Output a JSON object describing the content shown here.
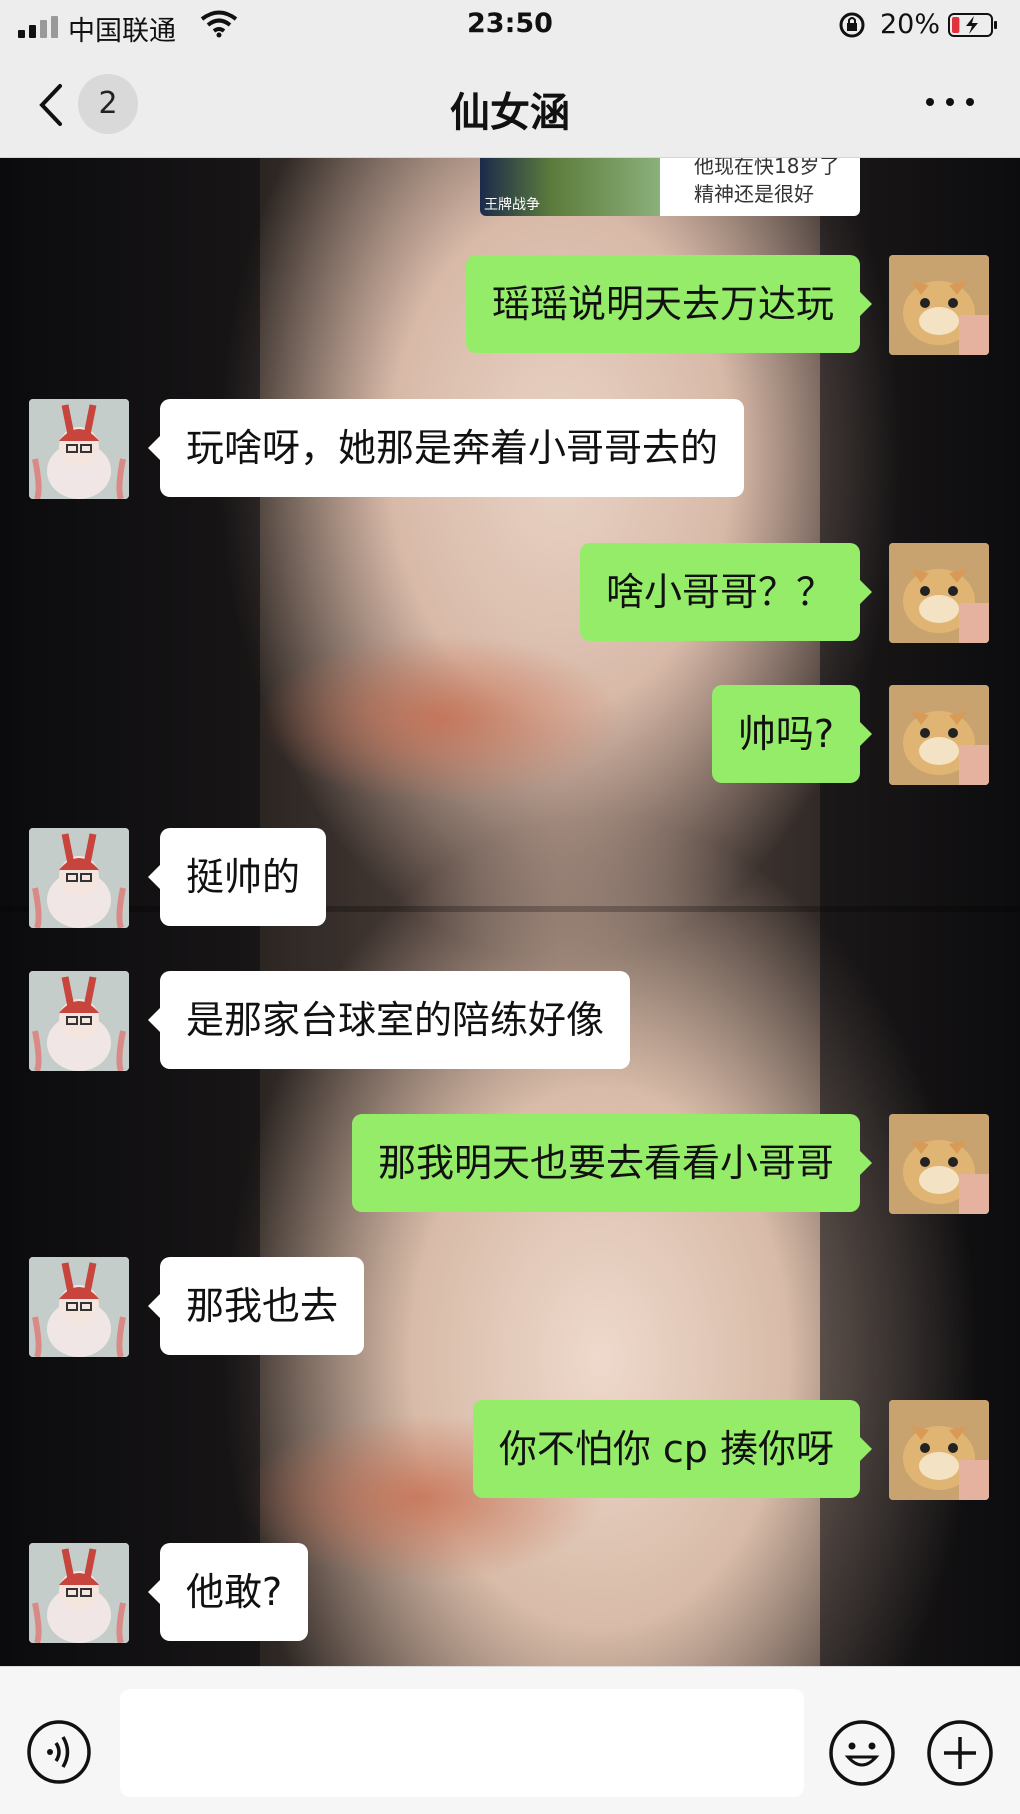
{
  "status_bar": {
    "carrier": "中国联通",
    "time": "23:50",
    "battery_percent": "20%",
    "battery_level": 0.2,
    "icons": [
      "signal-icon",
      "wifi-icon",
      "orientation-lock-icon",
      "battery-charging-icon"
    ]
  },
  "nav": {
    "back_icon": "chevron-left-icon",
    "unread_count": "2",
    "title": "仙女涵",
    "more_icon": "more-dots-icon"
  },
  "quoted_image": {
    "caption": "王牌战争",
    "text_line1": "他现在快18岁了",
    "text_line2": "精神还是很好"
  },
  "messages": [
    {
      "side": "me",
      "text": "瑶瑶说明天去万达玩"
    },
    {
      "side": "them",
      "text": "玩啥呀，她那是奔着小哥哥去的"
    },
    {
      "side": "me",
      "text": "啥小哥哥？？"
    },
    {
      "side": "me",
      "text": "帅吗?"
    },
    {
      "side": "them",
      "text": "挺帅的"
    },
    {
      "side": "them",
      "text": "是那家台球室的陪练好像"
    },
    {
      "side": "me",
      "text": "那我明天也要去看看小哥哥"
    },
    {
      "side": "them",
      "text": "那我也去"
    },
    {
      "side": "me",
      "text": "你不怕你 cp 揍你呀"
    },
    {
      "side": "them",
      "text": "他敢?"
    }
  ],
  "input_bar": {
    "voice_icon": "voice-icon",
    "placeholder": "",
    "emoji_icon": "emoji-icon",
    "plus_icon": "plus-icon"
  },
  "colors": {
    "my_bubble": "#95ec69",
    "their_bubble": "#ffffff",
    "header_bg": "#ededed"
  }
}
